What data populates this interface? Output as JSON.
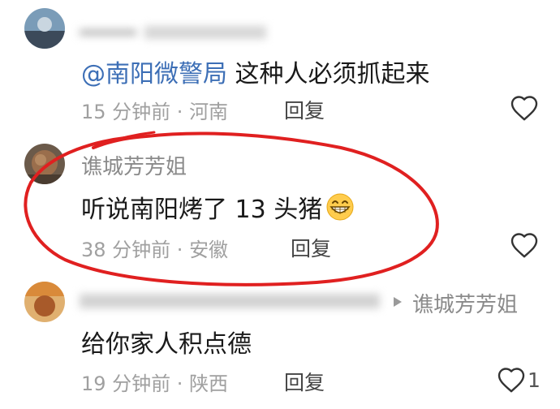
{
  "comments": [
    {
      "username": "",
      "text_mention": "@南阳微警局",
      "text_body": " 这种人必须抓起来",
      "time": "15 分钟前",
      "location": "河南",
      "reply_label": "回复",
      "likes": ""
    },
    {
      "username": "谯城芳芳姐",
      "text_body": "听说南阳烤了 13 头猪",
      "emoji": "grinning-face-emoji",
      "time": "38 分钟前",
      "location": "安徽",
      "reply_label": "回复",
      "likes": ""
    },
    {
      "username": "",
      "reply_to": "谯城芳芳姐",
      "text_body": "给你家人积点德",
      "time": "19 分钟前",
      "location": "陕西",
      "reply_label": "回复",
      "likes": "1"
    }
  ],
  "separator": " · ",
  "colors": {
    "mention": "#3d6fb6",
    "highlight_ring": "#e02020",
    "meta_gray": "#a0a0a0"
  },
  "icons": {
    "like": "heart-outline-icon",
    "reply_arrow": "play-triangle-icon",
    "emoji": "grinning-face-emoji"
  }
}
